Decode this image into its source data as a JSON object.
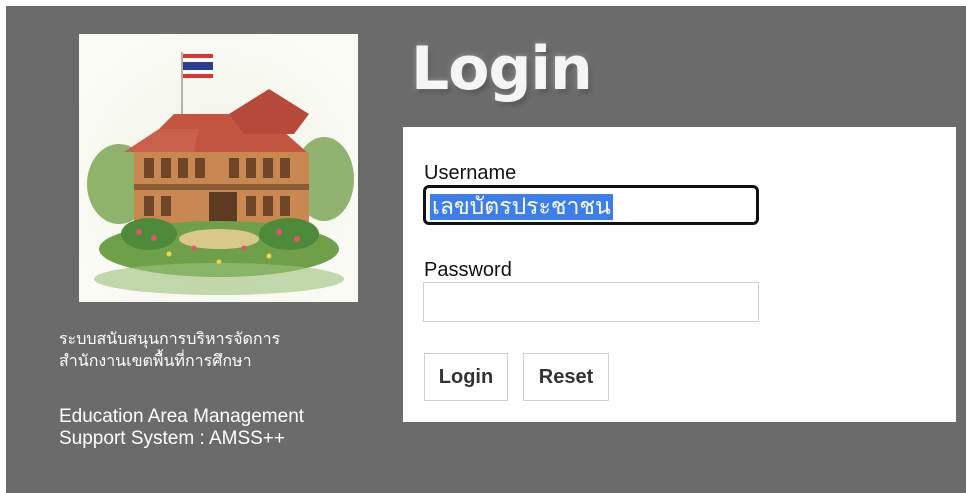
{
  "sidebar": {
    "system_name_th_line1": "ระบบสนับสนุนการบริหารจัดการ",
    "system_name_th_line2": "สำนักงานเขตพื้นที่การศึกษา",
    "system_name_en_line1": "Education Area Management",
    "system_name_en_line2": "Support System : AMSS++"
  },
  "login": {
    "title": "Login",
    "username_label": "Username",
    "username_value": "เลขบัตรประชาชน",
    "password_label": "Password",
    "password_value": "",
    "login_button": "Login",
    "reset_button": "Reset"
  },
  "colors": {
    "background": "#6b6b6b",
    "form_bg": "#ffffff",
    "selection": "#3d7eea"
  }
}
